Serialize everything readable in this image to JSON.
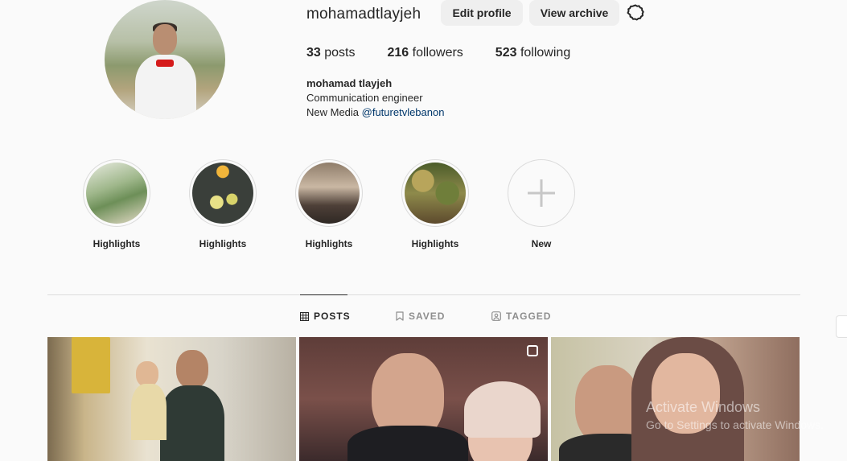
{
  "profile": {
    "username": "mohamadtlayjeh",
    "edit_label": "Edit profile",
    "archive_label": "View archive",
    "stats": {
      "posts_count": "33",
      "posts_label": "posts",
      "followers_count": "216",
      "followers_label": "followers",
      "following_count": "523",
      "following_label": "following"
    },
    "full_name": "mohamad tlayjeh",
    "bio_line1": "Communication engineer",
    "bio_line2_prefix": "New Media ",
    "bio_mention": "@futuretvlebanon"
  },
  "highlights": [
    {
      "label": "Highlights"
    },
    {
      "label": "Highlights"
    },
    {
      "label": "Highlights"
    },
    {
      "label": "Highlights"
    },
    {
      "label": "New"
    }
  ],
  "tabs": {
    "posts": "POSTS",
    "saved": "SAVED",
    "tagged": "TAGGED"
  },
  "watermark": {
    "line1": "Activate Windows",
    "line2": "Go to Settings to activate Windows."
  },
  "colors": {
    "mention": "#00376b",
    "button_bg": "#efefef",
    "divider": "#dbdbdb"
  },
  "icons": [
    "settings-gear-icon",
    "grid-icon",
    "bookmark-icon",
    "tag-user-icon",
    "plus-icon",
    "multi-post-icon"
  ]
}
